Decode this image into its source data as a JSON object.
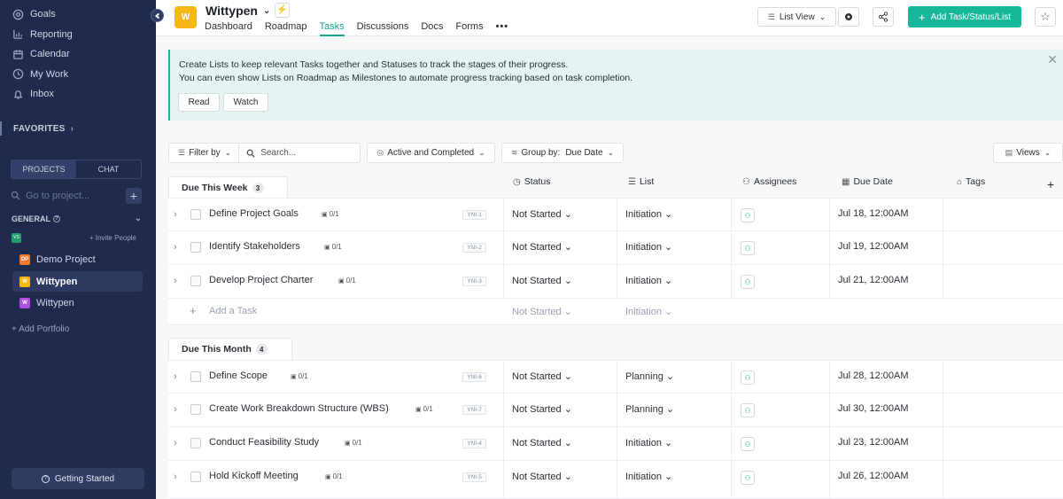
{
  "sidebar": {
    "nav": [
      {
        "label": "Goals",
        "icon": "goals-icon"
      },
      {
        "label": "Reporting",
        "icon": "reporting-icon"
      },
      {
        "label": "Calendar",
        "icon": "calendar-icon"
      },
      {
        "label": "My Work",
        "icon": "my-work-icon"
      },
      {
        "label": "Inbox",
        "icon": "inbox-icon"
      }
    ],
    "favorites_label": "FAVORITES",
    "segment": {
      "projects": "PROJECTS",
      "chat": "CHAT"
    },
    "goto_placeholder": "Go to project...",
    "general_label": "GENERAL",
    "workspace_badge": "VS",
    "invite_label": "+ Invite People",
    "projects": [
      {
        "label": "Demo Project",
        "badge": "DP",
        "color": "#f27a2e"
      },
      {
        "label": "Wittypen",
        "badge": "W",
        "color": "#f6b817"
      },
      {
        "label": "Wittypen",
        "badge": "W",
        "color": "#b04ee0"
      }
    ],
    "add_portfolio": "+ Add Portfolio",
    "getting_started": "Getting Started"
  },
  "header": {
    "logo_letter": "W",
    "title": "Wittypen",
    "tabs": [
      "Dashboard",
      "Roadmap",
      "Tasks",
      "Discussions",
      "Docs",
      "Forms",
      "•••"
    ],
    "active_tab": "Tasks",
    "view_label": "List View",
    "add_button": "Add Task/Status/List"
  },
  "banner": {
    "line1": "Create Lists to keep relevant Tasks together and Statuses to track the stages of their progress.",
    "line2": "You can even show Lists on Roadmap as Milestones to automate progress tracking based on task completion.",
    "read": "Read",
    "watch": "Watch"
  },
  "toolbar": {
    "filter": "Filter by",
    "search_placeholder": "Search...",
    "active_completed": "Active and Completed",
    "group_by_label": "Group by:",
    "group_by_value": "Due Date",
    "views": "Views"
  },
  "columns": {
    "status": "Status",
    "list": "List",
    "assignees": "Assignees",
    "due": "Due Date",
    "tags": "Tags"
  },
  "groups": [
    {
      "title": "Due This Week",
      "count": "3",
      "tasks": [
        {
          "name": "Define Project Goals",
          "sub": "0/1",
          "id": "YNI-1",
          "status": "Not Started",
          "list": "Initiation",
          "due": "Jul 18, 12:00AM"
        },
        {
          "name": "Identify Stakeholders",
          "sub": "0/1",
          "id": "YNI-2",
          "status": "Not Started",
          "list": "Initiation",
          "due": "Jul 19, 12:00AM"
        },
        {
          "name": "Develop Project Charter",
          "sub": "0/1",
          "id": "YNI-3",
          "status": "Not Started",
          "list": "Initiation",
          "due": "Jul 21, 12:00AM"
        }
      ],
      "add_task": "Add a Task",
      "add_status": "Not Started",
      "add_list": "Initiation"
    },
    {
      "title": "Due This Month",
      "count": "4",
      "tasks": [
        {
          "name": "Define Scope",
          "sub": "0/1",
          "id": "YNI-6",
          "status": "Not Started",
          "list": "Planning",
          "due": "Jul 28, 12:00AM"
        },
        {
          "name": "Create Work Breakdown Structure (WBS)",
          "sub": "0/1",
          "id": "YNI-7",
          "status": "Not Started",
          "list": "Planning",
          "due": "Jul 30, 12:00AM"
        },
        {
          "name": "Conduct Feasibility Study",
          "sub": "0/1",
          "id": "YNI-4",
          "status": "Not Started",
          "list": "Initiation",
          "due": "Jul 23, 12:00AM"
        },
        {
          "name": "Hold Kickoff Meeting",
          "sub": "0/1",
          "id": "YNI-5",
          "status": "Not Started",
          "list": "Initiation",
          "due": "Jul 26, 12:00AM"
        }
      ]
    }
  ]
}
